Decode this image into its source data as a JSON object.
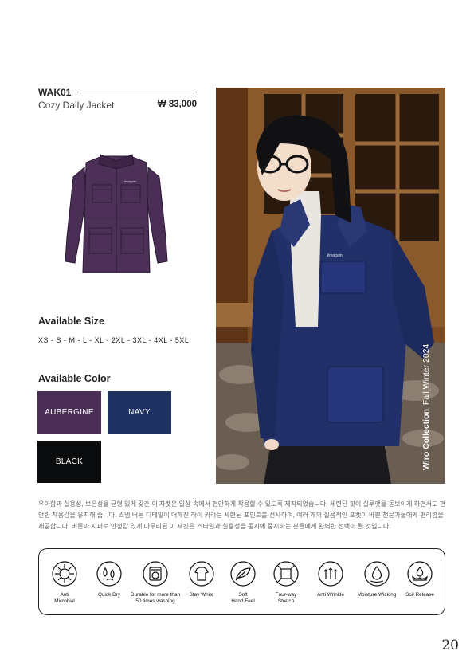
{
  "product": {
    "code": "WAK01",
    "name": "Cozy Daily Jacket",
    "price": "₩ 83,000",
    "logo_text": "ilmagain"
  },
  "sizes": {
    "title": "Available Size",
    "list": "XS - S - M - L - XL - 2XL - 3XL - 4XL - 5XL"
  },
  "colors": {
    "title": "Available Color",
    "swatches": [
      {
        "name": "AUBERGINE",
        "hex": "#4a2e55"
      },
      {
        "name": "NAVY",
        "hex": "#1f3363"
      },
      {
        "name": "BLACK",
        "hex": "#0b0c0e"
      }
    ]
  },
  "photo": {
    "collection": "Wiro Collection",
    "season": "Fall Winter 2024"
  },
  "description": "우아함과 실용성, 보온성을 균형 있게 갖춘 이 자켓은 일상 속에서 편안하게 착용할 수 있도록 제작되었습니다. 세련된 핏이 실루엣을 돋보이게 하면서도 편안한 착용감을 유지해 줍니다. 스냅 버튼 디테일이 더해진 하이 카라는 세련된 포인트를 선사하며, 여러 개의 실용적인 포켓이 바쁜 전문가들에게 편리함을 제공합니다. 버튼과 지퍼로 안정감 있게 마무리된 이 재킷은 스타일과 실용성을 동시에 중시하는 분들에게 완벽한 선택이 될 것입니다.",
  "features": [
    {
      "label": "Anti\nMicrobial",
      "icon": "anti-microbial-icon"
    },
    {
      "label": "Quick Dry",
      "icon": "quick-dry-icon"
    },
    {
      "label": "Durable for more than\n50 times washing",
      "icon": "washing-machine-icon"
    },
    {
      "label": "Stay White",
      "icon": "stay-white-icon"
    },
    {
      "label": "Soft\nHand Feel",
      "icon": "feather-icon"
    },
    {
      "label": "Four-way\nStretch",
      "icon": "stretch-icon"
    },
    {
      "label": "Anti Wrinkle",
      "icon": "anti-wrinkle-icon"
    },
    {
      "label": "Moisture Wicking",
      "icon": "moisture-wicking-icon"
    },
    {
      "label": "Soil Release",
      "icon": "soil-release-icon"
    }
  ],
  "page_number": "20"
}
